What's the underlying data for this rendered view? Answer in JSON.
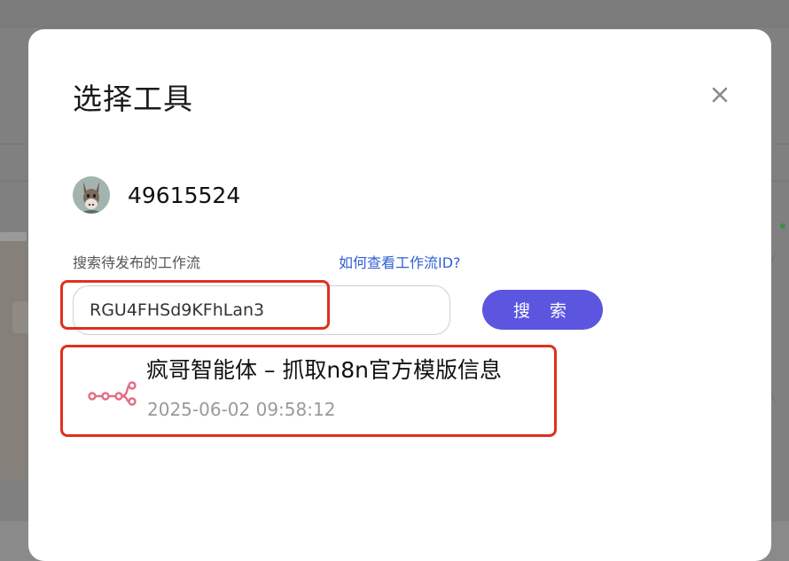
{
  "dialog": {
    "title": "选择工具",
    "close_icon": "close-icon"
  },
  "user": {
    "id": "49615524",
    "avatar_icon": "donkey-avatar-icon"
  },
  "search": {
    "label": "搜索待发布的工作流",
    "help_link": "如何查看工作流ID?",
    "value": "RGU4FHSd9KFhLan3",
    "button_label": "搜 索"
  },
  "results": [
    {
      "name": "疯哥智能体 – 抓取n8n官方模版信息",
      "timestamp": "2025-06-02 09:58:12",
      "icon": "n8n-workflow-icon"
    }
  ],
  "colors": {
    "accent": "#5b55e0",
    "highlight": "#e0301e",
    "link": "#2f5fd6",
    "n8n": "#e26d84"
  }
}
